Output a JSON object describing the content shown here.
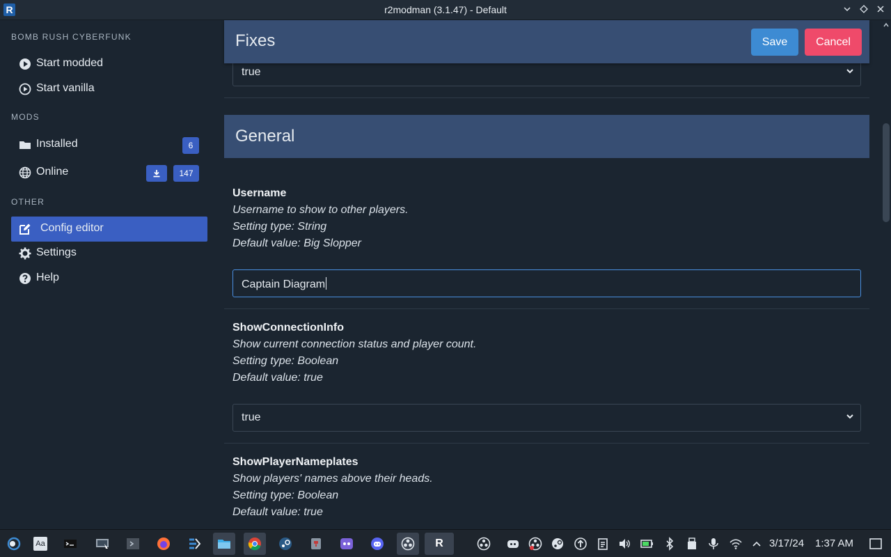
{
  "window": {
    "title": "r2modman (3.1.47) - Default",
    "logo_letter": "R",
    "controls": {
      "minimize": "⌄",
      "maximize": "◇",
      "close": "✕"
    }
  },
  "sidebar": {
    "game_label": "BOMB RUSH CYBERFUNK",
    "start_modded": "Start modded",
    "start_vanilla": "Start vanilla",
    "mods_label": "MODS",
    "installed_label": "Installed",
    "installed_count": "6",
    "online_label": "Online",
    "online_count": "147",
    "other_label": "OTHER",
    "config_editor": "Config editor",
    "settings": "Settings",
    "help": "Help"
  },
  "editor": {
    "section_title": "Fixes",
    "save_label": "Save",
    "cancel_label": "Cancel",
    "fixes_value": "true",
    "general_title": "General",
    "settings": [
      {
        "name": "Username",
        "description": "Username to show to other players.",
        "type": "Setting type: String",
        "default": "Default value: Big Slopper",
        "value": "Captain Diagram"
      },
      {
        "name": "ShowConnectionInfo",
        "description": "Show current connection status and player count.",
        "type": "Setting type: Boolean",
        "default": "Default value: true",
        "value": "true"
      },
      {
        "name": "ShowPlayerNameplates",
        "description": "Show players' names above their heads.",
        "type": "Setting type: Boolean",
        "default": "Default value: true"
      }
    ]
  },
  "taskbar": {
    "date": "3/17/24",
    "time": "1:37 AM",
    "active_app_letter": "R",
    "dictionary_label": "Aa"
  },
  "colors": {
    "accent": "#3a5fc2",
    "save": "#3d8bd3",
    "cancel": "#ef4a6a",
    "header": "#374e73",
    "background": "#1b2530"
  }
}
